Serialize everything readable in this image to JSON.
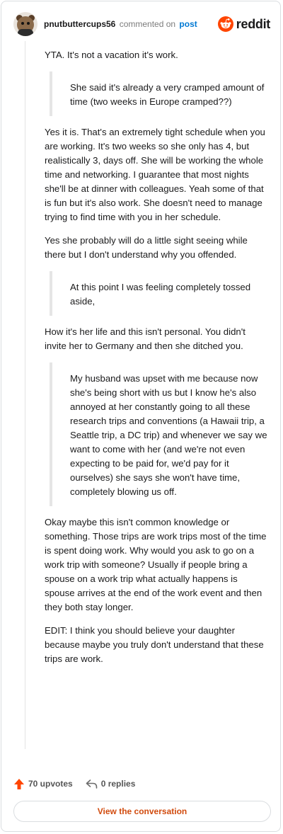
{
  "header": {
    "username": "pnutbuttercups56",
    "action": "commented on",
    "post_link": "post",
    "brand": "reddit"
  },
  "comment": {
    "p1": "YTA. It's not a vacation it's work.",
    "q1": "She said it's already a very cramped amount of time (two weeks in Europe cramped??)",
    "p2": "Yes it is. That's an extremely tight schedule when you are working. It's two weeks so she only has 4, but realistically 3, days off. She will be working the whole time and networking. I guarantee that most nights she'll be at dinner with colleagues. Yeah some of that is fun but it's also work. She doesn't need to manage trying to find time with you in her schedule.",
    "p3": "Yes she probably will do a little sight seeing while there but I don't understand why you offended.",
    "q2": "At this point I was feeling completely tossed aside,",
    "p4": "How it's her life and this isn't personal. You didn't invite her to Germany and then she ditched you.",
    "q3": "My husband was upset with me because now she's being short with us but I know he's also annoyed at her constantly going to all these research trips and conventions (a Hawaii trip, a Seattle trip, a DC trip) and whenever we say we want to come with her (and we're not even expecting to be paid for, we'd pay for it ourselves) she says she won't have time, completely blowing us off.",
    "p5": "Okay maybe this isn't common knowledge or something. Those trips are work trips most of the time is spent doing work. Why would you ask to go on a work trip with someone? Usually if people bring a spouse on a work trip what actually happens is spouse arrives at the end of the work event and then they both stay longer.",
    "p6": "EDIT: I think you should believe your daughter because maybe you truly don't understand that these trips are work."
  },
  "footer": {
    "upvotes": "70 upvotes",
    "replies": "0 replies",
    "view_button": "View the conversation"
  },
  "icons": {
    "avatar": "user-avatar",
    "logo": "reddit-alien-icon",
    "upvote": "upvote-arrow-icon",
    "reply": "reply-arrow-icon"
  },
  "colors": {
    "brand": "#ff4500",
    "link": "#0079d3",
    "button_text": "#d14b0e"
  }
}
